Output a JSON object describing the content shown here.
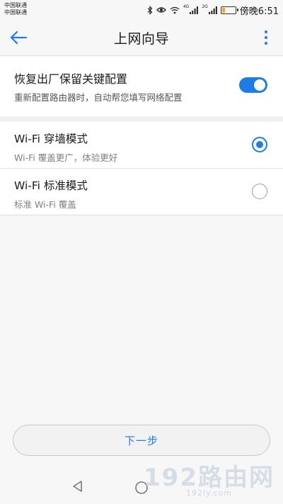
{
  "status_bar": {
    "carrier_line_1": "中国联通",
    "carrier_line_2": "中国联通",
    "network_1": "4G",
    "network_2": "2G",
    "time": "傍晚6:51",
    "battery_level": 0.2,
    "battery_color": "#f5a623"
  },
  "header": {
    "title": "上网向导",
    "back_icon": "arrow-left-icon",
    "menu_icon": "more-vertical-icon"
  },
  "restore": {
    "title": "恢复出厂保留关键配置",
    "subtitle": "重新配置路由器时，自动帮您填写网络配置",
    "enabled": true
  },
  "modes": [
    {
      "title": "Wi-Fi 穿墙模式",
      "subtitle": "Wi-Fi 覆盖更广，体验更好",
      "selected": true
    },
    {
      "title": "Wi-Fi 标准模式",
      "subtitle": "标准 Wi-Fi 覆盖",
      "selected": false
    }
  ],
  "next_button": {
    "label": "下一步"
  },
  "watermark": {
    "main": "192路由网",
    "sub": "192ly.com"
  },
  "colors": {
    "accent": "#1f7be6",
    "background": "#f7f7f7"
  }
}
